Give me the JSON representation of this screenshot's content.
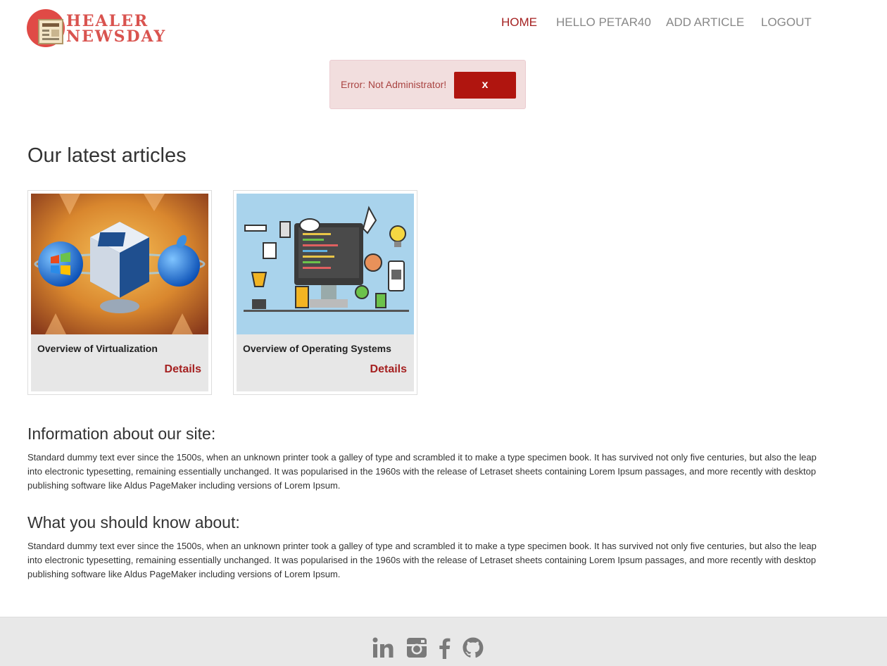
{
  "brand": {
    "line1": "HEALER",
    "line2": "NEWSDAY",
    "paper_label": "HEALER"
  },
  "nav": {
    "home": "HOME",
    "greeting": "HELLO PETAR40",
    "add_article": "ADD ARTICLE",
    "logout": "LOGOUT"
  },
  "alert": {
    "message": "Error: Not Administrator!",
    "close_label": "x"
  },
  "articles_heading": "Our latest articles",
  "articles": [
    {
      "title": "Overview of Virtualization",
      "link_label": "Details"
    },
    {
      "title": "Overview of Operating Systems",
      "link_label": "Details"
    }
  ],
  "info": {
    "heading": "Information about our site:",
    "body": "Standard dummy text ever since the 1500s, when an unknown printer took a galley of type and scrambled it to make a type specimen book. It has survived not only five centuries, but also the leap into electronic typesetting, remaining essentially unchanged. It was popularised in the 1960s with the release of Letraset sheets containing Lorem Ipsum passages, and more recently with desktop publishing software like Aldus PageMaker including versions of Lorem Ipsum."
  },
  "know": {
    "heading": "What you should know about:",
    "body": "Standard dummy text ever since the 1500s, when an unknown printer took a galley of type and scrambled it to make a type specimen book. It has survived not only five centuries, but also the leap into electronic typesetting, remaining essentially unchanged. It was popularised in the 1960s with the release of Letraset sheets containing Lorem Ipsum passages, and more recently with desktop publishing software like Aldus PageMaker including versions of Lorem Ipsum."
  },
  "footer": {
    "icons": [
      "linkedin-icon",
      "instagram-icon",
      "facebook-icon",
      "github-icon"
    ]
  },
  "colors": {
    "accent": "#a52121",
    "alert_bg": "#f2dede",
    "alert_text": "#a94442",
    "button": "#b0150f",
    "footer_bg": "#e8e8e8"
  }
}
